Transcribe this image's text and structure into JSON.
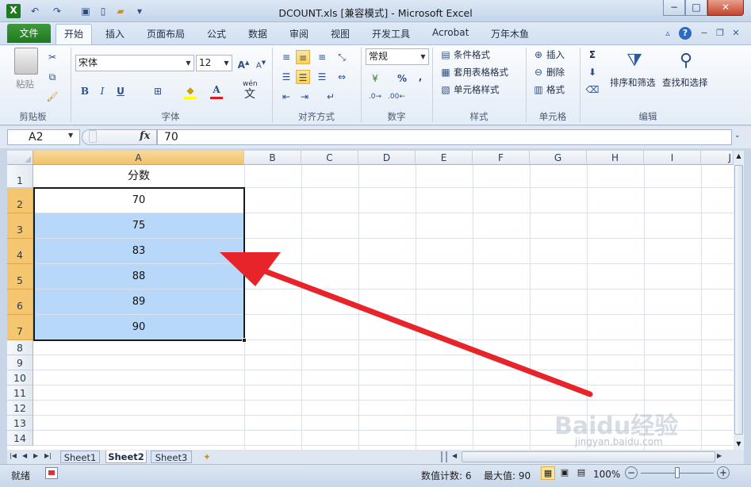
{
  "window": {
    "title": "DCOUNT.xls  [兼容模式] - Microsoft Excel",
    "controls": {
      "minimize": "−",
      "maximize": "□",
      "close": "✕"
    }
  },
  "quick_access": [
    "excel-logo-icon",
    "undo-icon",
    "redo-icon",
    "save-icon",
    "new-file-icon",
    "open-folder-icon",
    "customize-icon"
  ],
  "tabs": {
    "file": "文件",
    "items": [
      "开始",
      "插入",
      "页面布局",
      "公式",
      "数据",
      "审阅",
      "视图",
      "开发工具",
      "Acrobat",
      "万年木鱼"
    ]
  },
  "ribbon": {
    "clipboard": {
      "paste": "粘贴",
      "label": "剪贴板"
    },
    "font": {
      "name": "宋体",
      "size": "12",
      "bold": "B",
      "italic": "I",
      "underline": "U",
      "color_a": "A",
      "phonetic": "wén",
      "phonetic_char": "文",
      "label": "字体"
    },
    "alignment": {
      "label": "对齐方式"
    },
    "number": {
      "format": "常规",
      "percent": "%",
      "comma": ",",
      "label": "数字"
    },
    "styles": {
      "conditional": "条件格式",
      "table": "套用表格格式",
      "cell": "单元格样式",
      "label": "样式"
    },
    "cells": {
      "insert": "插入",
      "delete": "删除",
      "format": "格式",
      "label": "单元格"
    },
    "editing": {
      "sigma": "Σ",
      "sort_filter": "排序和筛选",
      "find_select": "查找和选择",
      "label": "编辑"
    }
  },
  "formula_bar": {
    "name_box": "A2",
    "fx": "fx",
    "value": "70"
  },
  "sheet": {
    "columns": [
      "A",
      "B",
      "C",
      "D",
      "E",
      "F",
      "G",
      "H",
      "I",
      "J"
    ],
    "rows": [
      "1",
      "2",
      "3",
      "4",
      "5",
      "6",
      "7",
      "8",
      "9",
      "10",
      "11",
      "12",
      "13",
      "14"
    ],
    "cells_A": [
      "分数",
      "70",
      "75",
      "83",
      "88",
      "89",
      "90"
    ]
  },
  "sheet_tabs": [
    "Sheet1",
    "Sheet2",
    "Sheet3"
  ],
  "status": {
    "ready": "就绪",
    "count": "数值计数: 6",
    "max": "最大值: 90",
    "zoom": "100%"
  },
  "watermark": {
    "brand": "Baidu经验",
    "url": "jingyan.baidu.com"
  },
  "colors": {
    "file_tab": "#1e7a1e",
    "selection_fill": "#b8d8fa",
    "header_selected": "#f5c670",
    "arrow": "#e8242b"
  }
}
